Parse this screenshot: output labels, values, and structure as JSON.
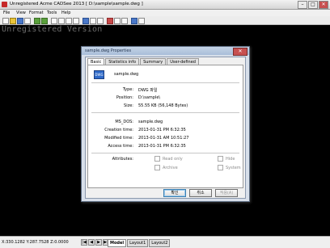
{
  "window": {
    "title": "Unregistered Acme CADSee 2013 [ D:\\sample\\sample.dwg ]",
    "controls": {
      "minimize": "–",
      "maximize": "□",
      "close": "✕"
    }
  },
  "menu": [
    "File",
    "View",
    "Format",
    "Tools",
    "Help"
  ],
  "watermark": "Unregistered Version",
  "status": {
    "coords": "X:330.1282 Y:287.7528 Z:0.0000",
    "tabs": [
      "Model",
      "Layout1",
      "Layout2"
    ],
    "nav": [
      "|◀",
      "◀",
      "▶",
      "▶|"
    ]
  },
  "dialog": {
    "title": "sample.dwg Properties",
    "close": "✕",
    "tabs": [
      "Basic",
      "Statistics info",
      "Summary",
      "User-defined"
    ],
    "file_icon_text": "DWG",
    "filename": "sample.dwg",
    "rows": [
      {
        "label": "Type:",
        "value": "DWG 파일"
      },
      {
        "label": "Position:",
        "value": "D:\\sample\\"
      },
      {
        "label": "Size:",
        "value": "55.55 KB (56,148 Bytes)"
      }
    ],
    "rows2": [
      {
        "label": "MS_DOS:",
        "value": "sample.dwg"
      },
      {
        "label": "Creation time:",
        "value": "2013-01-31 PM 6:32:35"
      },
      {
        "label": "Modified time:",
        "value": "2013-01-31 AM 10:51:27"
      },
      {
        "label": "Access time:",
        "value": "2013-01-31 PM 6:32:35"
      }
    ],
    "attributes_label": "Attributes:",
    "attributes": [
      "Read only",
      "Hide",
      "Archive",
      "System"
    ],
    "buttons": {
      "ok": "확인",
      "cancel": "취소",
      "apply": "적용(A)"
    }
  }
}
